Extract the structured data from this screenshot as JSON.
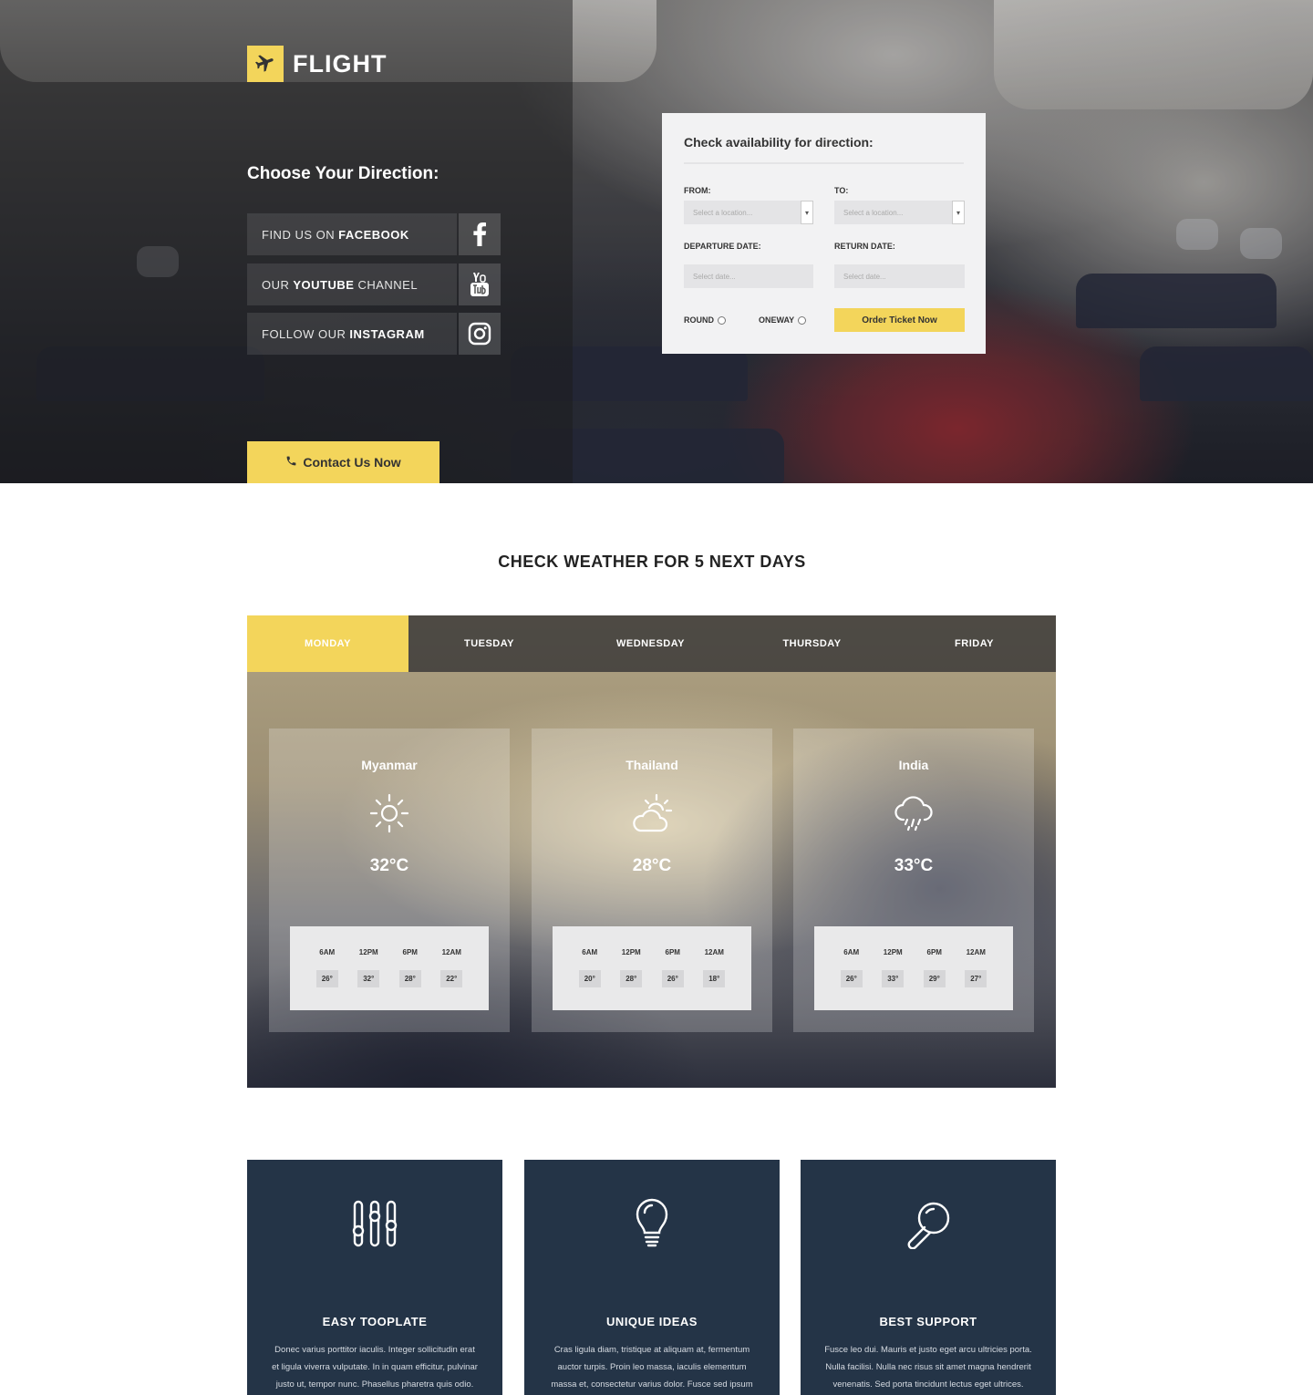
{
  "brand": {
    "name": "FLIGHT"
  },
  "hero": {
    "choose_title": "Choose Your Direction:",
    "social": [
      {
        "prefix": "FIND US ON",
        "bold": "FACEBOOK",
        "suffix": "",
        "icon": "facebook-icon"
      },
      {
        "prefix": "OUR",
        "bold": "YOUTUBE",
        "suffix": "CHANNEL",
        "icon": "youtube-icon"
      },
      {
        "prefix": "FOLLOW OUR",
        "bold": "INSTAGRAM",
        "suffix": "",
        "icon": "instagram-icon"
      }
    ],
    "contact_label": "Contact Us Now"
  },
  "booking": {
    "title": "Check availability for direction:",
    "from_label": "FROM:",
    "to_label": "TO:",
    "from_placeholder": "Select a location...",
    "to_placeholder": "Select a location...",
    "departure_label": "DEPARTURE DATE:",
    "return_label": "RETURN DATE:",
    "departure_placeholder": "Select date...",
    "return_placeholder": "Select date...",
    "round_label": "ROUND",
    "oneway_label": "ONEWAY",
    "order_label": "Order Ticket Now"
  },
  "weather": {
    "title": "CHECK WEATHER FOR 5 NEXT DAYS",
    "tabs": [
      "MONDAY",
      "TUESDAY",
      "WEDNESDAY",
      "THURSDAY",
      "FRIDAY"
    ],
    "active_tab": "MONDAY",
    "hours": [
      "6AM",
      "12PM",
      "6PM",
      "12AM"
    ],
    "cards": [
      {
        "country": "Myanmar",
        "icon": "sun-icon",
        "temp": "32°C",
        "hourly": [
          "26°",
          "32°",
          "28°",
          "22°"
        ]
      },
      {
        "country": "Thailand",
        "icon": "partly-cloudy-icon",
        "temp": "28°C",
        "hourly": [
          "20°",
          "28°",
          "26°",
          "18°"
        ]
      },
      {
        "country": "India",
        "icon": "rain-cloud-icon",
        "temp": "33°C",
        "hourly": [
          "26°",
          "33°",
          "29°",
          "27°"
        ]
      }
    ]
  },
  "features": [
    {
      "title": "EASY TOOPLATE",
      "icon": "sliders-icon",
      "text": "Donec varius porttitor iaculis. Integer sollicitudin erat et ligula viverra vulputate. In in quam efficitur, pulvinar justo ut, tempor nunc. Phasellus pharetra quis odio."
    },
    {
      "title": "UNIQUE IDEAS",
      "icon": "lightbulb-icon",
      "text": "Cras ligula diam, tristique at aliquam at, fermentum auctor turpis. Proin leo massa, iaculis elementum massa et, consectetur varius dolor. Fusce sed ipsum sit."
    },
    {
      "title": "BEST SUPPORT",
      "icon": "search-icon",
      "text": "Fusce leo dui. Mauris et justo eget arcu ultricies porta. Nulla facilisi. Nulla nec risus sit amet magna hendrerit venenatis. Sed porta tincidunt lectus eget ultrices."
    }
  ],
  "colors": {
    "accent": "#f3d55b",
    "feature_bg": "#243447",
    "booking_bg": "#f2f2f3"
  }
}
